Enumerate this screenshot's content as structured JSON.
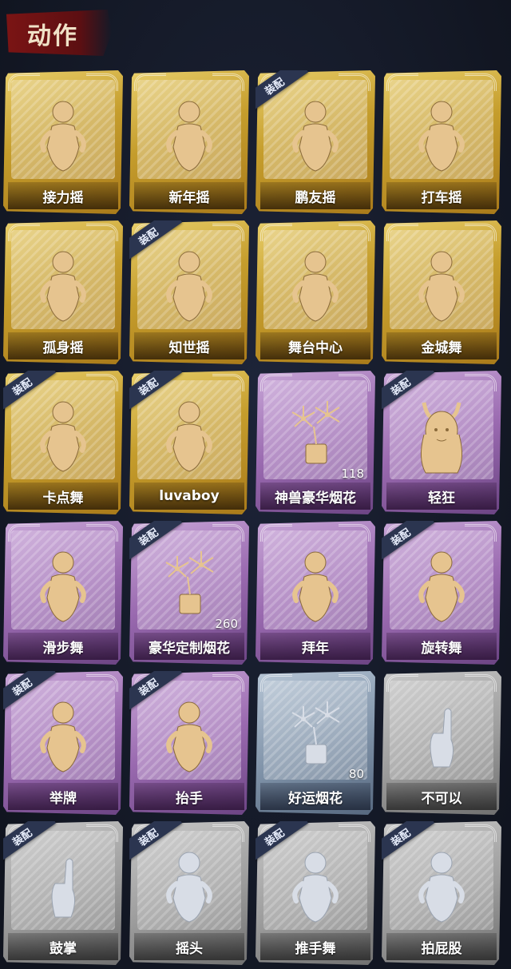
{
  "header": {
    "title": "动作"
  },
  "equip_label": "装配",
  "items": [
    {
      "label": "接力摇",
      "tier": "gold",
      "equipped": false,
      "icon": "dance-figure-icon",
      "count": ""
    },
    {
      "label": "新年摇",
      "tier": "gold",
      "equipped": false,
      "icon": "dance-figure-icon",
      "count": ""
    },
    {
      "label": "鹏友摇",
      "tier": "gold",
      "equipped": true,
      "icon": "dance-figure-icon",
      "count": ""
    },
    {
      "label": "打车摇",
      "tier": "gold",
      "equipped": false,
      "icon": "dance-figure-icon",
      "count": ""
    },
    {
      "label": "孤身摇",
      "tier": "gold",
      "equipped": false,
      "icon": "dance-figure-icon",
      "count": ""
    },
    {
      "label": "知世摇",
      "tier": "gold",
      "equipped": true,
      "icon": "dance-figure-icon",
      "count": ""
    },
    {
      "label": "舞台中心",
      "tier": "gold",
      "equipped": false,
      "icon": "dance-figure-icon",
      "count": ""
    },
    {
      "label": "金城舞",
      "tier": "gold",
      "equipped": false,
      "icon": "dance-figure-icon",
      "count": ""
    },
    {
      "label": "卡点舞",
      "tier": "gold",
      "equipped": true,
      "icon": "dance-figure-icon",
      "count": ""
    },
    {
      "label": "luvaboy",
      "tier": "gold",
      "equipped": true,
      "icon": "dance-figure-icon",
      "count": ""
    },
    {
      "label": "神兽豪华烟花",
      "tier": "purple",
      "equipped": false,
      "icon": "fireworks-icon",
      "count": "118"
    },
    {
      "label": "轻狂",
      "tier": "purple",
      "equipped": true,
      "icon": "horned-character-icon",
      "count": ""
    },
    {
      "label": "滑步舞",
      "tier": "purple",
      "equipped": false,
      "icon": "dance-figure-icon",
      "count": ""
    },
    {
      "label": "豪华定制烟花",
      "tier": "purple",
      "equipped": true,
      "icon": "fireworks-icon",
      "count": "260"
    },
    {
      "label": "拜年",
      "tier": "purple",
      "equipped": false,
      "icon": "bow-figure-icon",
      "count": ""
    },
    {
      "label": "旋转舞",
      "tier": "purple",
      "equipped": true,
      "icon": "spin-figure-icon",
      "count": ""
    },
    {
      "label": "举牌",
      "tier": "purple",
      "equipped": true,
      "icon": "sign-figure-icon",
      "count": ""
    },
    {
      "label": "抬手",
      "tier": "purple",
      "equipped": true,
      "icon": "raise-hand-icon",
      "count": ""
    },
    {
      "label": "好运烟花",
      "tier": "blue",
      "equipped": false,
      "icon": "fireworks-icon",
      "count": "80"
    },
    {
      "label": "不可以",
      "tier": "gray",
      "equipped": false,
      "icon": "finger-wag-icon",
      "count": ""
    },
    {
      "label": "鼓掌",
      "tier": "gray",
      "equipped": true,
      "icon": "clap-hands-icon",
      "count": ""
    },
    {
      "label": "摇头",
      "tier": "gray",
      "equipped": true,
      "icon": "shake-head-icon",
      "count": ""
    },
    {
      "label": "推手舞",
      "tier": "gray",
      "equipped": true,
      "icon": "push-dance-icon",
      "count": ""
    },
    {
      "label": "拍屁股",
      "tier": "gray",
      "equipped": true,
      "icon": "slap-figure-icon",
      "count": ""
    }
  ]
}
